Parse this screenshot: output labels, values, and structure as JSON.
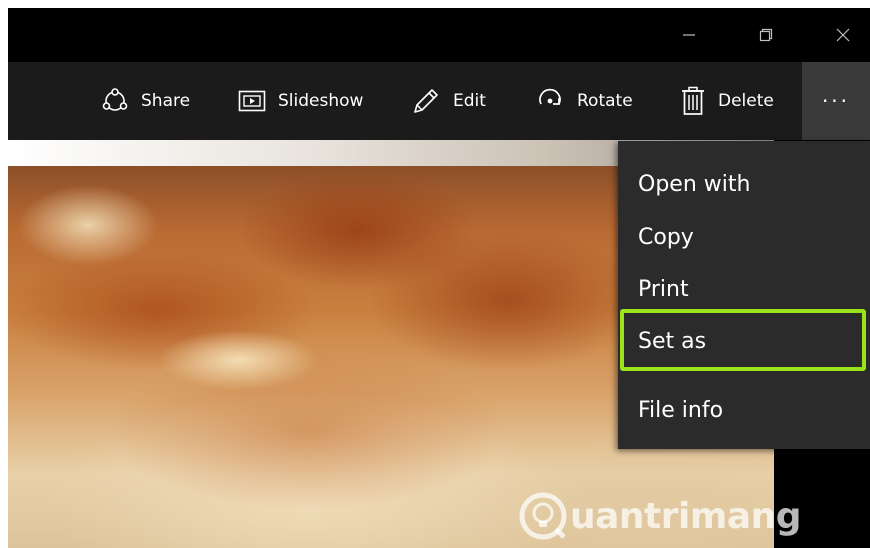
{
  "window": {
    "caption": {
      "minimize_icon": "minimize-icon",
      "restore_icon": "restore-icon",
      "close_icon": "close-icon"
    }
  },
  "commands": {
    "share": "Share",
    "slideshow": "Slideshow",
    "edit": "Edit",
    "rotate": "Rotate",
    "delete": "Delete",
    "more": "···"
  },
  "menu": {
    "items": [
      {
        "label": "Open with"
      },
      {
        "label": "Copy"
      },
      {
        "label": "Print"
      },
      {
        "label": "Set as"
      },
      {
        "label": "File info"
      }
    ],
    "highlighted_item": "Set as",
    "highlight_color": "#9be21a"
  },
  "watermark": {
    "text": "uantrimang"
  },
  "colors": {
    "titlebar": "#000000",
    "commandbar": "#1b1b1b",
    "more_button": "#3a3a3a",
    "menu_background": "#2b2b2b",
    "text": "#ffffff"
  }
}
